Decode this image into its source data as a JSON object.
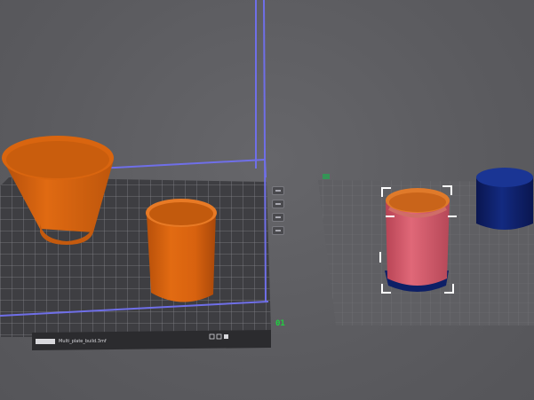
{
  "viewport": {
    "background": "#5e5e61",
    "bed_number": "01",
    "bed_caption": "Multi_plate_build.3mf",
    "colors": {
      "bed_border": "#6f6fe8",
      "grid_line": "#7a7a7e",
      "object_orange": "#e0680f",
      "object_selected": "#d85a6a",
      "object_dark_blue": "#0d1f66",
      "selection_bracket": "#ffffff"
    }
  },
  "bed_toolbar": {
    "icons": [
      "arrange-icon",
      "orient-icon",
      "lock-icon",
      "settings-icon"
    ]
  },
  "objects": [
    {
      "name": "cone-cup",
      "state": "unselected"
    },
    {
      "name": "cylinder-cup",
      "state": "unselected"
    },
    {
      "name": "selected-cup",
      "state": "selected"
    },
    {
      "name": "blue-cylinder",
      "state": "unselected"
    }
  ]
}
